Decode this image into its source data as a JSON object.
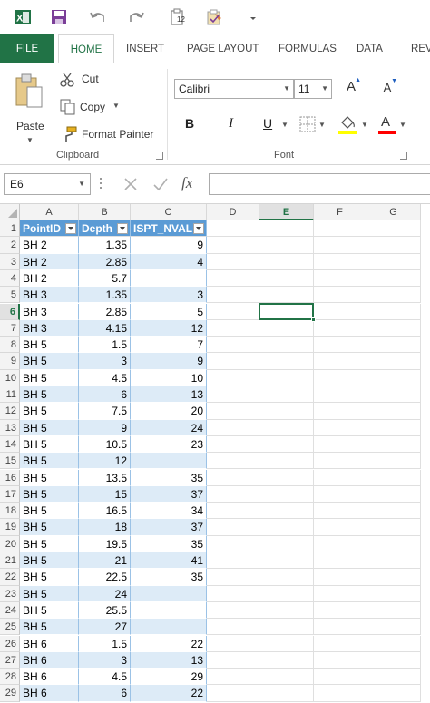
{
  "qat": {
    "icons": [
      "excel-logo-icon",
      "save-icon",
      "undo-icon",
      "redo-icon",
      "clipboard-count-icon",
      "spellcheck-icon",
      "customize-qat-icon"
    ],
    "clipboard_count": "12"
  },
  "tabs": [
    {
      "label": "FILE"
    },
    {
      "label": "HOME"
    },
    {
      "label": "INSERT"
    },
    {
      "label": "PAGE LAYOUT"
    },
    {
      "label": "FORMULAS"
    },
    {
      "label": "DATA"
    },
    {
      "label": "REV"
    }
  ],
  "ribbon": {
    "clipboard": {
      "paste_label": "Paste",
      "cut_label": "Cut",
      "copy_label": "Copy",
      "format_painter_label": "Format Painter",
      "group_label": "Clipboard"
    },
    "font": {
      "font_name": "Calibri",
      "font_size": "11",
      "bold": "B",
      "italic": "I",
      "underline": "U",
      "grow": "A",
      "shrink": "A",
      "font_color_letter": "A",
      "group_label": "Font"
    }
  },
  "colors": {
    "brand": "#217346",
    "table_header": "#5b9bd5",
    "table_band": "#ddebf7",
    "highlight": "#ffff00",
    "font_color": "#ff0000"
  },
  "formula_bar": {
    "name_box": "E6",
    "fx": "fx",
    "value": ""
  },
  "grid": {
    "columns": [
      "A",
      "B",
      "C",
      "D",
      "E",
      "F",
      "G"
    ],
    "selected_column": "E",
    "selected_row": "6",
    "table_headers": [
      "PointID",
      "Depth",
      "ISPT_NVAL"
    ],
    "rows": [
      {
        "n": "2",
        "a": "BH 2",
        "b": "1.35",
        "c": "9"
      },
      {
        "n": "3",
        "a": "BH 2",
        "b": "2.85",
        "c": "4"
      },
      {
        "n": "4",
        "a": "BH 2",
        "b": "5.7",
        "c": ""
      },
      {
        "n": "5",
        "a": "BH 3",
        "b": "1.35",
        "c": "3"
      },
      {
        "n": "6",
        "a": "BH 3",
        "b": "2.85",
        "c": "5"
      },
      {
        "n": "7",
        "a": "BH 3",
        "b": "4.15",
        "c": "12"
      },
      {
        "n": "8",
        "a": "BH 5",
        "b": "1.5",
        "c": "7"
      },
      {
        "n": "9",
        "a": "BH 5",
        "b": "3",
        "c": "9"
      },
      {
        "n": "10",
        "a": "BH 5",
        "b": "4.5",
        "c": "10"
      },
      {
        "n": "11",
        "a": "BH 5",
        "b": "6",
        "c": "13"
      },
      {
        "n": "12",
        "a": "BH 5",
        "b": "7.5",
        "c": "20"
      },
      {
        "n": "13",
        "a": "BH 5",
        "b": "9",
        "c": "24"
      },
      {
        "n": "14",
        "a": "BH 5",
        "b": "10.5",
        "c": "23"
      },
      {
        "n": "15",
        "a": "BH 5",
        "b": "12",
        "c": ""
      },
      {
        "n": "16",
        "a": "BH 5",
        "b": "13.5",
        "c": "35"
      },
      {
        "n": "17",
        "a": "BH 5",
        "b": "15",
        "c": "37"
      },
      {
        "n": "18",
        "a": "BH 5",
        "b": "16.5",
        "c": "34"
      },
      {
        "n": "19",
        "a": "BH 5",
        "b": "18",
        "c": "37"
      },
      {
        "n": "20",
        "a": "BH 5",
        "b": "19.5",
        "c": "35"
      },
      {
        "n": "21",
        "a": "BH 5",
        "b": "21",
        "c": "41"
      },
      {
        "n": "22",
        "a": "BH 5",
        "b": "22.5",
        "c": "35"
      },
      {
        "n": "23",
        "a": "BH 5",
        "b": "24",
        "c": ""
      },
      {
        "n": "24",
        "a": "BH 5",
        "b": "25.5",
        "c": ""
      },
      {
        "n": "25",
        "a": "BH 5",
        "b": "27",
        "c": ""
      },
      {
        "n": "26",
        "a": "BH 6",
        "b": "1.5",
        "c": "22"
      },
      {
        "n": "27",
        "a": "BH 6",
        "b": "3",
        "c": "13"
      },
      {
        "n": "28",
        "a": "BH 6",
        "b": "4.5",
        "c": "29"
      },
      {
        "n": "29",
        "a": "BH 6",
        "b": "6",
        "c": "22"
      }
    ]
  }
}
